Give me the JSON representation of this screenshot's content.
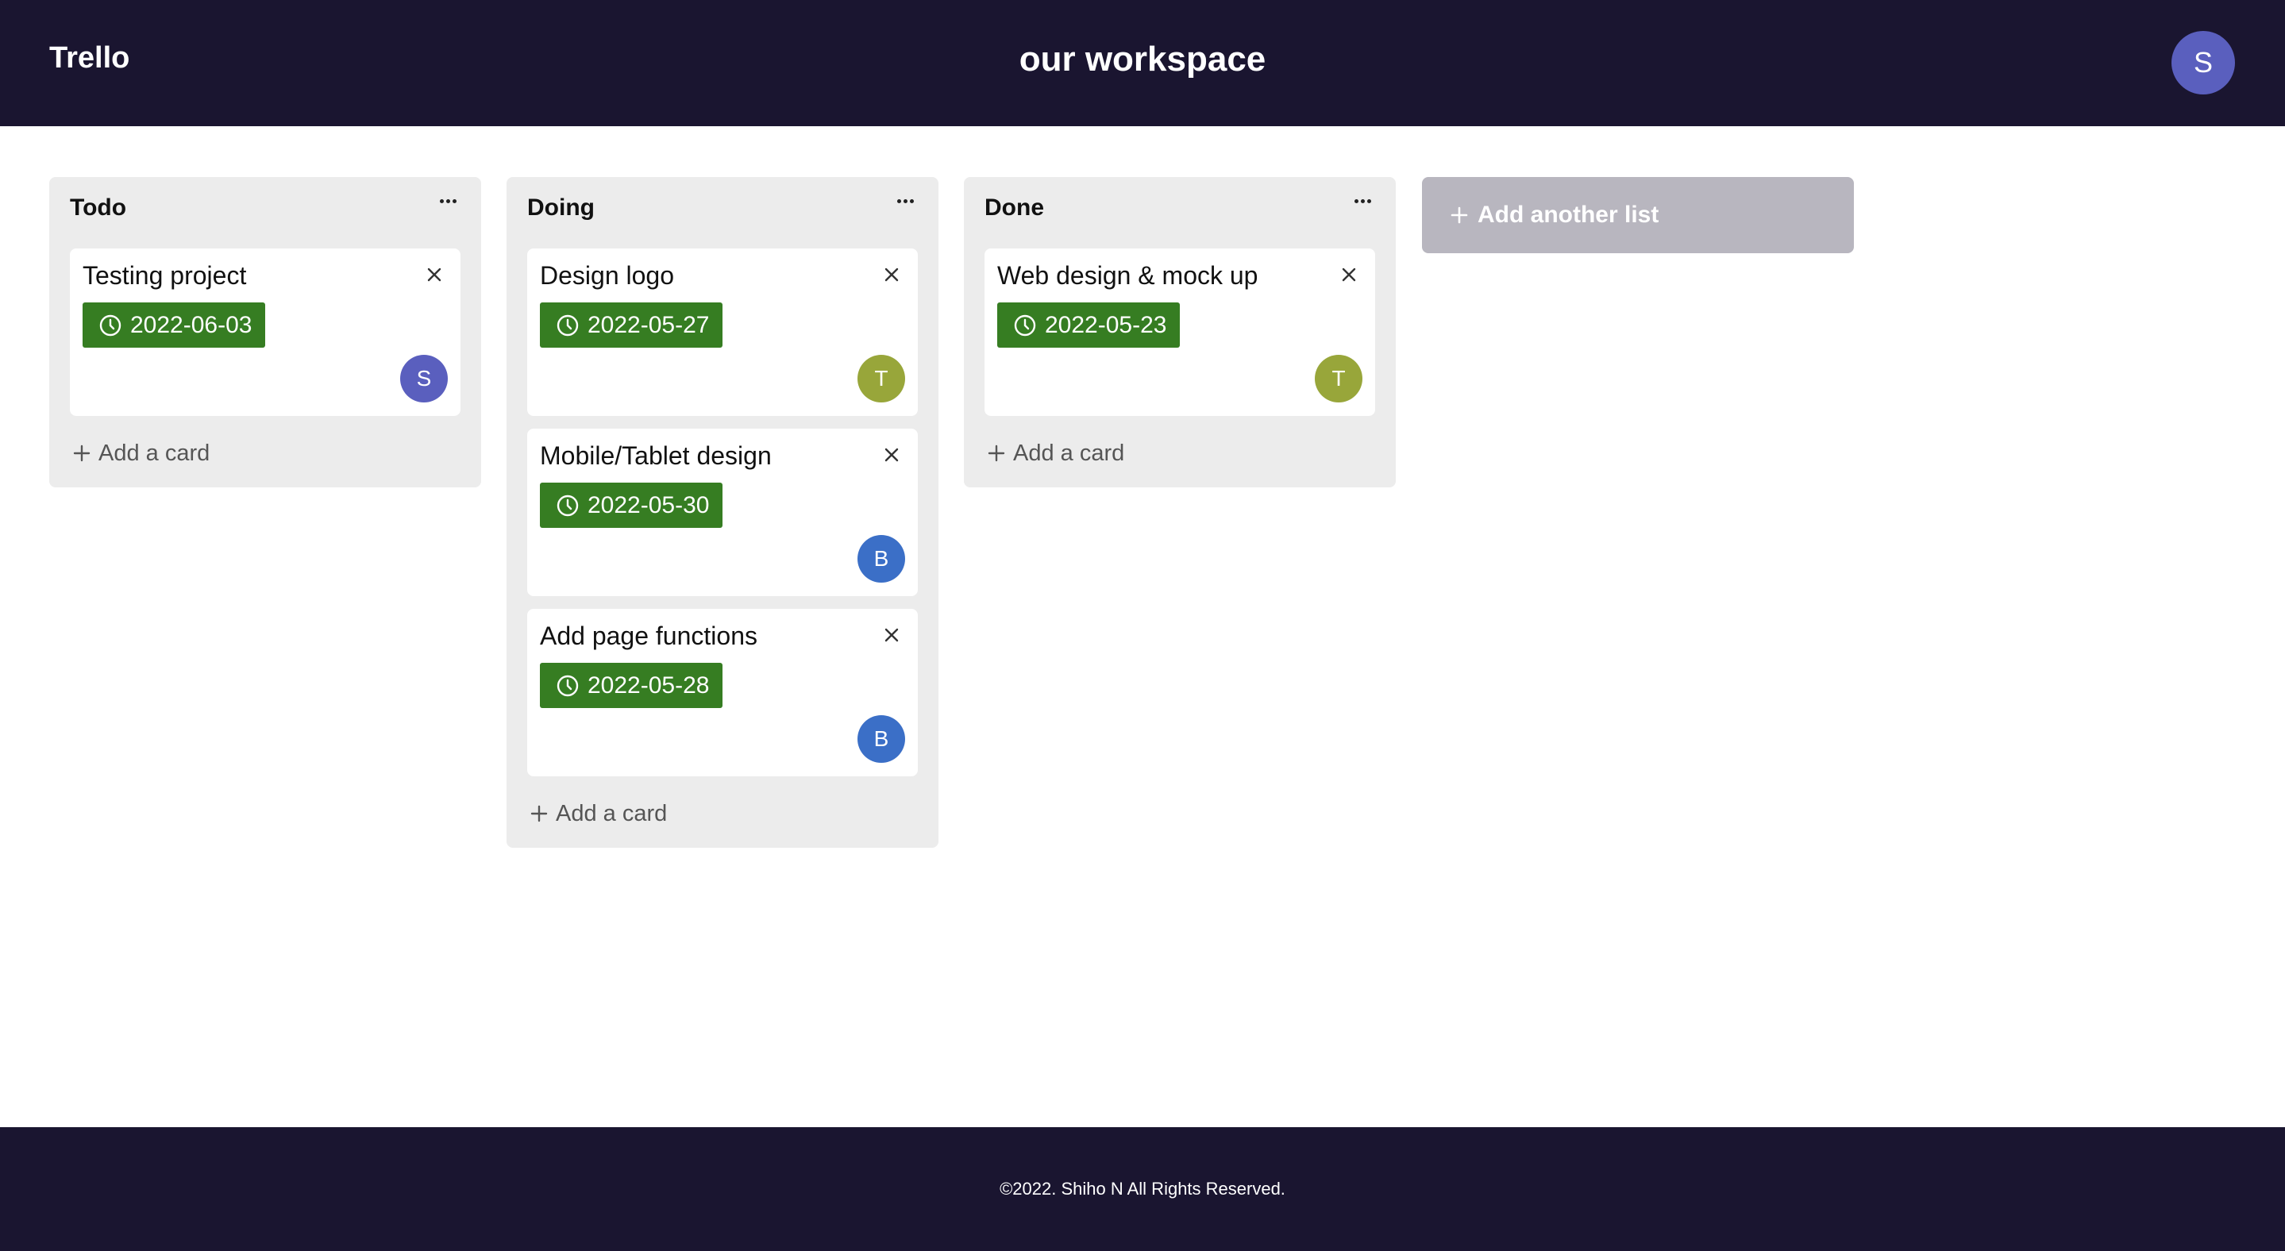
{
  "header": {
    "logo": "Trello",
    "board_title": "our workspace",
    "user_initial": "S",
    "user_color": "#5a5fbe"
  },
  "lists": [
    {
      "title": "Todo",
      "add_card_label": "Add a card",
      "cards": [
        {
          "title": "Testing project",
          "due": "2022-06-03",
          "assignee": "S",
          "assignee_color": "#5a5fbe"
        }
      ]
    },
    {
      "title": "Doing",
      "add_card_label": "Add a card",
      "cards": [
        {
          "title": "Design logo",
          "due": "2022-05-27",
          "assignee": "T",
          "assignee_color": "#98a63a"
        },
        {
          "title": "Mobile/Tablet design",
          "due": "2022-05-30",
          "assignee": "B",
          "assignee_color": "#3b6fc7"
        },
        {
          "title": "Add page functions",
          "due": "2022-05-28",
          "assignee": "B",
          "assignee_color": "#3b6fc7"
        }
      ]
    },
    {
      "title": "Done",
      "add_card_label": "Add a card",
      "cards": [
        {
          "title": "Web design & mock up",
          "due": "2022-05-23",
          "assignee": "T",
          "assignee_color": "#98a63a"
        }
      ]
    }
  ],
  "add_list_label": "Add another list",
  "footer": {
    "copyright": "©2022. Shiho N All Rights Reserved."
  },
  "colors": {
    "header_bg": "#1a1530",
    "list_bg": "#ececec",
    "due_badge": "#367d22",
    "add_list_bg": "#b8b6bf"
  },
  "icons": {
    "list_menu": "more-horizontal-icon",
    "card_close": "close-icon",
    "due": "clock-icon",
    "add": "plus-icon"
  }
}
